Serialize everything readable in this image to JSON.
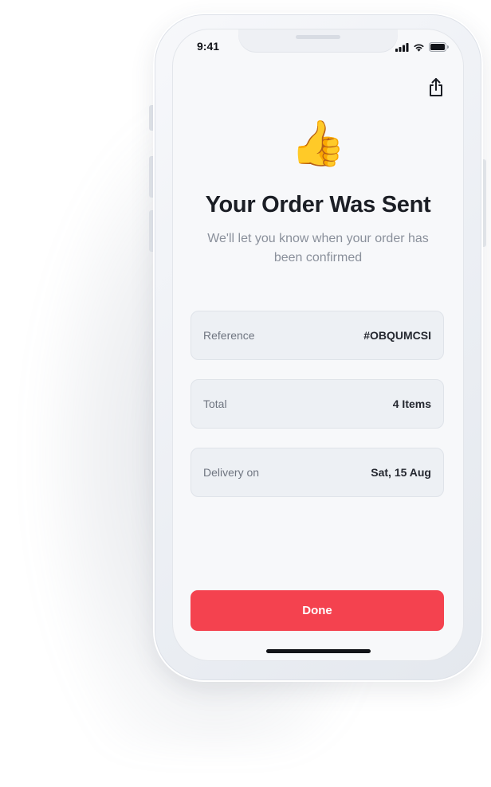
{
  "status_bar": {
    "time": "9:41",
    "icons": [
      "cellular-signal-icon",
      "wifi-icon",
      "battery-icon"
    ]
  },
  "header": {
    "share_icon": "share-icon"
  },
  "confirmation": {
    "emoji": "👍",
    "title": "Your Order Was Sent",
    "subtitle": "We'll let you know when your order has been confirmed"
  },
  "details": [
    {
      "label": "Reference",
      "value": "#OBQUMCSI"
    },
    {
      "label": "Total",
      "value": "4 Items"
    },
    {
      "label": "Delivery on",
      "value": "Sat, 15 Aug"
    }
  ],
  "actions": {
    "done_label": "Done"
  },
  "colors": {
    "accent": "#f4424f",
    "card_background": "#edf0f4",
    "screen_background": "#f7f8fa",
    "title": "#1b1e25",
    "muted_text": "#8a909b"
  }
}
